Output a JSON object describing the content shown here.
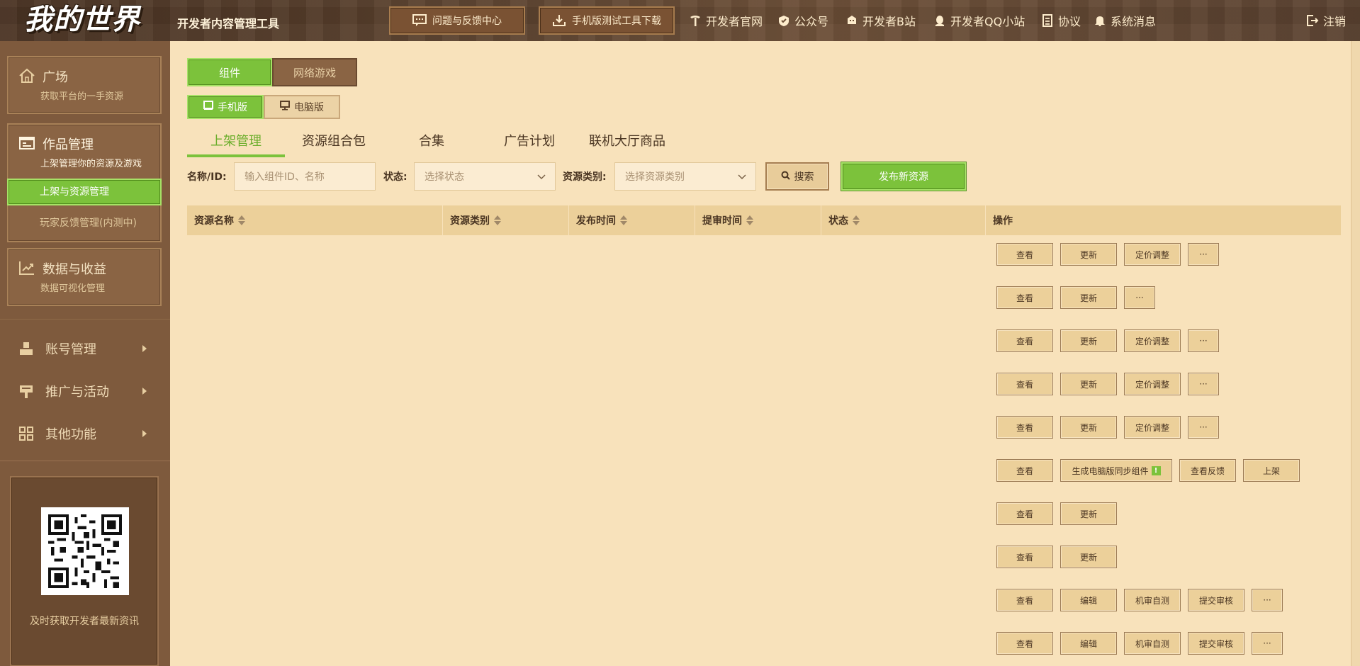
{
  "header": {
    "logo": "我的世界",
    "app_title": "开发者内容管理工具",
    "feedback_btn": "问题与反馈中心",
    "download_btn": "手机版测试工具下载",
    "links": [
      {
        "label": "开发者官网",
        "icon": "pickaxe-icon"
      },
      {
        "label": "公众号",
        "icon": "wechat-icon"
      },
      {
        "label": "开发者B站",
        "icon": "bilibili-icon"
      },
      {
        "label": "开发者QQ小站",
        "icon": "qq-icon"
      },
      {
        "label": "协议",
        "icon": "document-icon"
      },
      {
        "label": "系统消息",
        "icon": "bell-icon"
      }
    ],
    "logout": "注销"
  },
  "sidebar": {
    "home": {
      "title": "广场",
      "sub": "获取平台的一手资源"
    },
    "works": {
      "title": "作品管理",
      "sub": "上架管理你的资源及游戏"
    },
    "works_items": [
      "上架与资源管理",
      "玩家反馈管理(内测中)"
    ],
    "data": {
      "title": "数据与收益",
      "sub": "数据可视化管理"
    },
    "menus": [
      "账号管理",
      "推广与活动",
      "其他功能"
    ],
    "qr_caption": "及时获取开发者最新资讯"
  },
  "main": {
    "seg_type": [
      "组件",
      "网络游戏"
    ],
    "seg_platform": [
      "手机版",
      "电脑版"
    ],
    "tabs": [
      "上架管理",
      "资源组合包",
      "合集",
      "广告计划",
      "联机大厅商品"
    ],
    "filters": {
      "name_label": "名称/ID:",
      "name_placeholder": "输入组件ID、名称",
      "status_label": "状态:",
      "status_placeholder": "选择状态",
      "category_label": "资源类别:",
      "category_placeholder": "选择资源类别",
      "search_btn": "搜索",
      "publish_btn": "发布新资源"
    },
    "table": {
      "columns": [
        "资源名称",
        "资源类别",
        "发布时间",
        "提审时间",
        "状态",
        "操作"
      ],
      "rows": [
        [
          "查看",
          "更新",
          "定价调整",
          "···"
        ],
        [
          "查看",
          "更新",
          "···"
        ],
        [
          "查看",
          "更新",
          "定价调整",
          "···"
        ],
        [
          "查看",
          "更新",
          "定价调整",
          "···"
        ],
        [
          "查看",
          "更新",
          "定价调整",
          "···"
        ],
        [
          "查看",
          "生成电脑版同步组件",
          "查看反馈",
          "上架"
        ],
        [
          "查看",
          "更新"
        ],
        [
          "查看",
          "更新"
        ],
        [
          "查看",
          "编辑",
          "机审自测",
          "提交审核",
          "···"
        ],
        [
          "查看",
          "编辑",
          "机审自测",
          "提交审核",
          "···"
        ]
      ],
      "warn_badge": "!"
    }
  },
  "colors": {
    "accent_green": "#7cc23b",
    "bg": "#f8e2bb",
    "sidebar": "#7e5a3d",
    "header": "#5e4430"
  }
}
